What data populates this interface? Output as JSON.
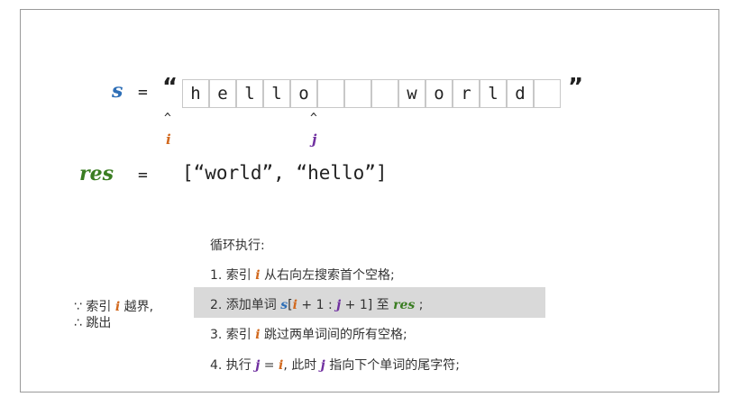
{
  "colors": {
    "s": "#2e6fb7",
    "i": "#d2691e",
    "j": "#7030a0",
    "res": "#3a7d22"
  },
  "s_line": {
    "var": "s",
    "eq": "=",
    "open_quote": "“",
    "close_quote": "”",
    "cells": [
      "h",
      "e",
      "l",
      "l",
      "o",
      "",
      "",
      "",
      "w",
      "o",
      "r",
      "l",
      "d",
      ""
    ]
  },
  "pointers": {
    "i": {
      "caret": "^",
      "label": "i"
    },
    "j": {
      "caret": "^",
      "label": "j"
    }
  },
  "res_line": {
    "var": "res",
    "eq": "=",
    "value": "[“world”, “hello”]"
  },
  "condition": {
    "because": "∵ 索引",
    "var_i": "i",
    "out": "越界,",
    "therefore": "∴ 跳出"
  },
  "loop": {
    "title": "循环执行:",
    "step1": {
      "prefix": "1. 索引",
      "var_i": "i",
      "suffix": "从右向左搜索首个空格;"
    },
    "step2": {
      "prefix": "2. 添加单词",
      "s": "s",
      "lb": "[",
      "i": "i",
      "mid": "+ 1 :",
      "j": "j",
      "end": "+ 1]",
      "to": "至",
      "res": "res",
      "semi": ";"
    },
    "step3": {
      "prefix": "3. 索引",
      "var_i": "i",
      "suffix": "跳过两单词间的所有空格;"
    },
    "step4": {
      "prefix": "4. 执行",
      "j": "j",
      "eq": "=",
      "i": "i",
      "mid": ", 此时",
      "j2": "j",
      "suffix": "指向下个单词的尾字符;"
    }
  }
}
